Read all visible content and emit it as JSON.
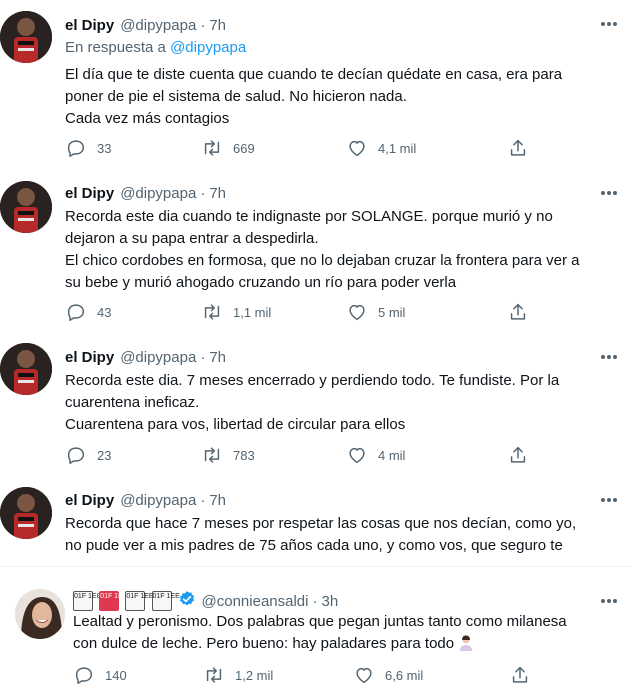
{
  "tweets": [
    {
      "name": "el Dipy",
      "handle": "@dipypapa",
      "time": "7h",
      "reply_prefix": "En respuesta a",
      "reply_handle": "@dipypapa",
      "lines": [
        "El día que te diste cuenta que cuando te decían quédate en casa, era para",
        "poner de pie el sistema de salud. No hicieron nada.",
        "Cada vez más contagios"
      ],
      "replies": "33",
      "retweets": "669",
      "likes": "4,1 mil"
    },
    {
      "name": "el Dipy",
      "handle": "@dipypapa",
      "time": "7h",
      "lines": [
        "Recorda este dia cuando te indignaste por SOLANGE. porque murió y no",
        "dejaron a su papa entrar a despedirla.",
        "El chico cordobes en formosa, que no lo dejaban cruzar la frontera para ver a",
        "su bebe y murió ahogado cruzando un río para poder verla"
      ],
      "replies": "43",
      "retweets": "1,1 mil",
      "likes": "5 mil"
    },
    {
      "name": "el Dipy",
      "handle": "@dipypapa",
      "time": "7h",
      "lines": [
        "Recorda este dia. 7 meses encerrado y perdiendo todo. Te fundiste. Por la",
        "cuarentena ineficaz.",
        "Cuarentena para vos, libertad de circular para ellos"
      ],
      "replies": "23",
      "retweets": "783",
      "likes": "4 mil"
    },
    {
      "name": "el Dipy",
      "handle": "@dipypapa",
      "time": "7h",
      "lines": [
        "Recorda que hace 7 meses por respetar las cosas que nos decían, como yo,",
        "no pude ver a mis padres de 75 años cada uno, y como vos, que seguro te"
      ]
    },
    {
      "name_glyphs": [
        "01F 1E8",
        "01F 1E6",
        "01F 1EE",
        "01F 1EE"
      ],
      "handle": "@connieansaldi",
      "time": "3h",
      "lines": [
        "Lealtad y peronismo. Dos palabras que pegan juntas tanto como milanesa",
        "con dulce de leche. Pero bueno: hay paladares para todo"
      ],
      "replies": "140",
      "retweets": "1,2 mil",
      "likes": "6,6 mil"
    }
  ],
  "colors": {
    "accent": "#1d9bf0",
    "secondary_text": "#536471",
    "verified": "#1d9bf0"
  },
  "icons": [
    "reply-icon",
    "retweet-icon",
    "like-icon",
    "share-icon",
    "more-icon",
    "verified-icon"
  ]
}
